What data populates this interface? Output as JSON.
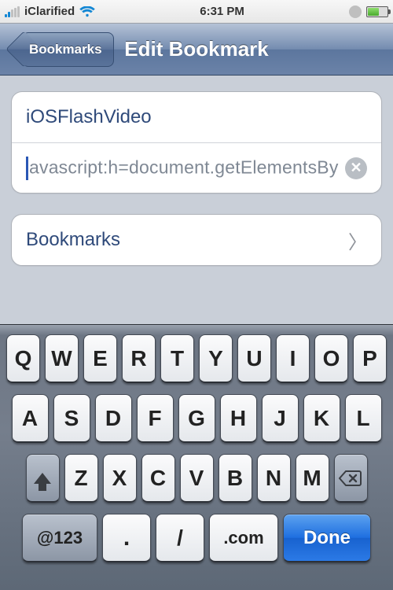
{
  "status": {
    "carrier": "iClarified",
    "time": "6:31 PM"
  },
  "nav": {
    "back_label": "Bookmarks",
    "title": "Edit Bookmark"
  },
  "form": {
    "name_value": "iOSFlashVideo",
    "url_value": "avascript:h=document.getElementsByT",
    "folder_label": "Bookmarks"
  },
  "keyboard": {
    "row1": [
      "Q",
      "W",
      "E",
      "R",
      "T",
      "Y",
      "U",
      "I",
      "O",
      "P"
    ],
    "row2": [
      "A",
      "S",
      "D",
      "F",
      "G",
      "H",
      "J",
      "K",
      "L"
    ],
    "row3": [
      "Z",
      "X",
      "C",
      "V",
      "B",
      "N",
      "M"
    ],
    "mode": "@123",
    "period": ".",
    "slash": "/",
    "dotcom": ".com",
    "done": "Done"
  }
}
